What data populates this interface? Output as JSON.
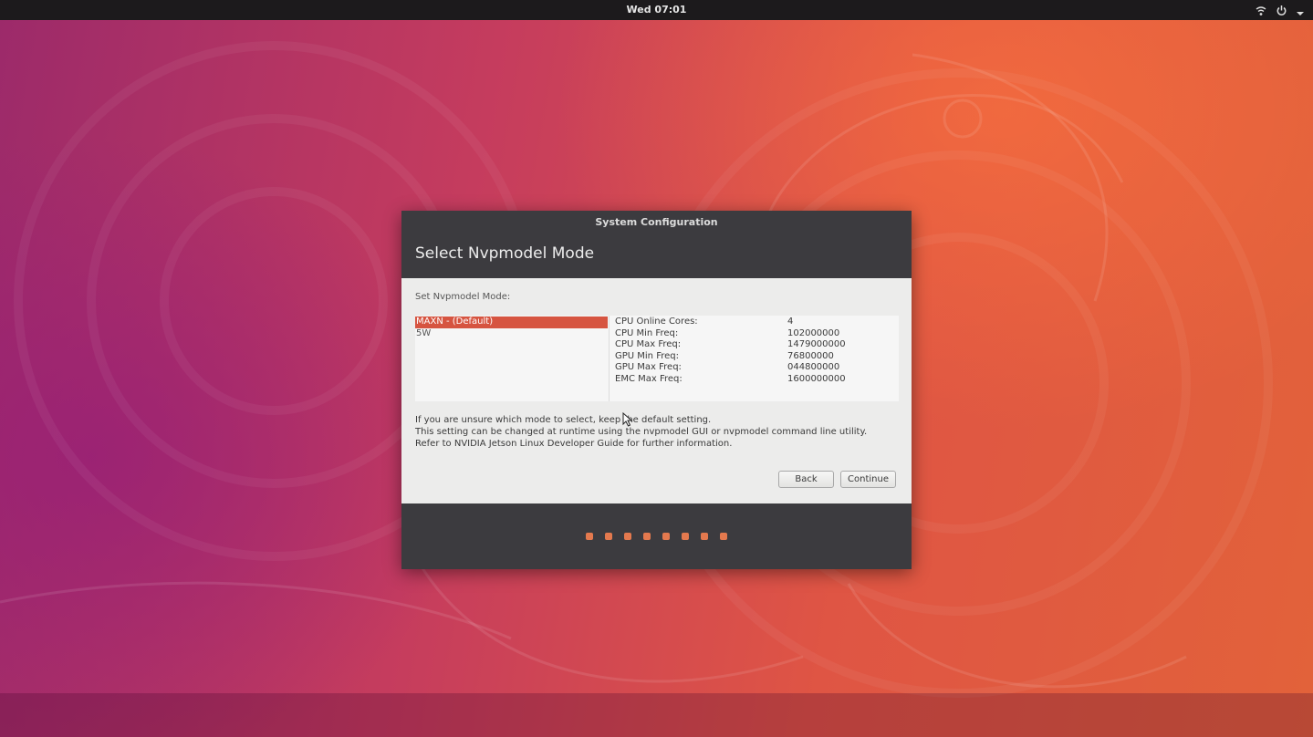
{
  "topbar": {
    "clock": "Wed 07:01",
    "icons": [
      "network-icon",
      "power-icon",
      "chevron-down-icon"
    ]
  },
  "dialog": {
    "window_title": "System Configuration",
    "heading": "Select Nvpmodel Mode",
    "set_label": "Set Nvpmodel Mode:",
    "modes": [
      {
        "label": "MAXN - (Default)",
        "selected": true
      },
      {
        "label": "5W",
        "selected": false
      }
    ],
    "specs": [
      {
        "name": "CPU Online Cores:",
        "value": "4"
      },
      {
        "name": "CPU Min Freq:",
        "value": "102000000"
      },
      {
        "name": "CPU Max Freq:",
        "value": "1479000000"
      },
      {
        "name": "GPU Min Freq:",
        "value": "76800000"
      },
      {
        "name": "GPU Max Freq:",
        "value": "044800000"
      },
      {
        "name": "EMC Max Freq:",
        "value": "1600000000"
      }
    ],
    "info": [
      "If you are unsure which mode to select, keep the default setting.",
      "This setting can be changed at runtime using the nvpmodel GUI or nvpmodel command line utility.",
      "Refer to NVIDIA Jetson Linux Developer Guide for further information."
    ],
    "back_label": "Back",
    "continue_label": "Continue",
    "progress_steps": 8,
    "accent_color": "#d65440",
    "dot_color": "#e4794e"
  }
}
